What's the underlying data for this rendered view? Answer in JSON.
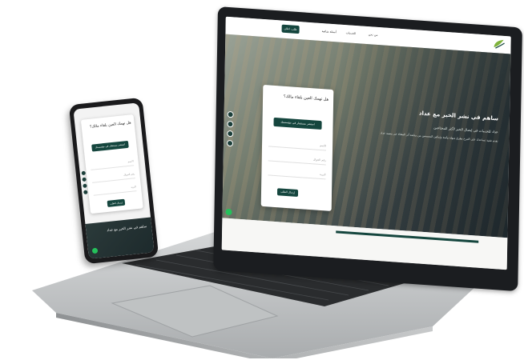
{
  "colors": {
    "brand": "#15463e",
    "whatsapp": "#25c05b",
    "laptop_body": "#c9cbcc"
  },
  "laptop": {
    "nav": {
      "cta": "طلب اعلان",
      "links": [
        "من نحن",
        "الخدمات",
        "أسئلة شائعة"
      ]
    },
    "hero": {
      "title": "ساهم في نشر الخير مع عداد",
      "subtitle": "عداد للخدمات في إيصال الخير لأكثر المحتاجين",
      "body": "نقدم تقنية تساعدك على التبرع بطرق سهلة وآمنة وتمكين المحسنين من متابعة أثر العطاء عبر منصة عداد"
    },
    "form": {
      "title": "هل تهمك العين بلقاء مالك؟",
      "primary_button": "استشر مستشار في مؤسستك",
      "fields": [
        "الاسم",
        "رقم الجوال",
        "البريد"
      ],
      "submit": "إرسال الطلب"
    },
    "icons": [
      "facebook-icon",
      "twitter-icon",
      "instagram-icon",
      "linkedin-icon",
      "whatsapp-icon"
    ]
  },
  "phone": {
    "form": {
      "title": "هل تهمك العين بلقاء مالك؟",
      "primary_button": "استشر مستشار في مؤسستك",
      "fields": [
        "الاسم",
        "رقم الجوال",
        "البريد"
      ],
      "submit": "إرسال الطلب"
    },
    "hero_text": "ساهم في نشر الخير مع عداد"
  }
}
